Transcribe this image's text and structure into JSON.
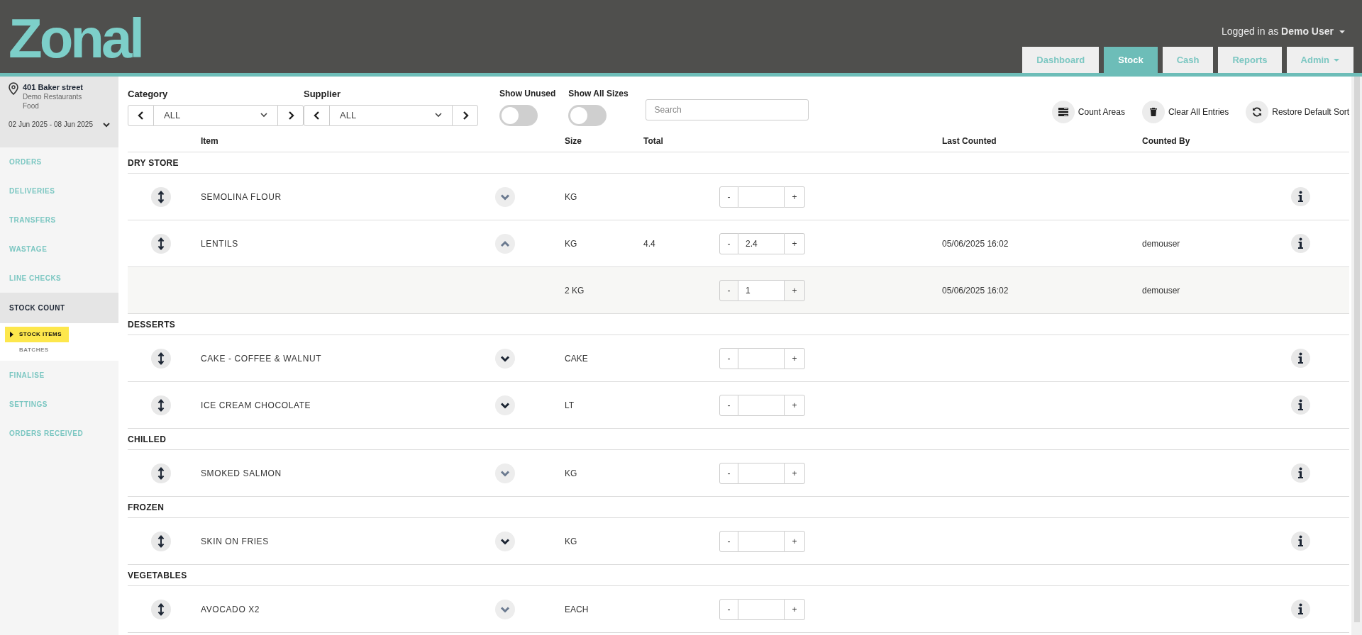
{
  "header": {
    "logo": "Zonal",
    "user": "Logged in as **Demo User**",
    "tabs": [
      {
        "label": "Dashboard",
        "selected": false,
        "dropdown": false
      },
      {
        "label": "Stock",
        "selected": true,
        "dropdown": false
      },
      {
        "label": "Cash",
        "selected": false,
        "dropdown": false
      },
      {
        "label": "Reports",
        "selected": false,
        "dropdown": false
      },
      {
        "label": "Admin",
        "selected": false,
        "dropdown": true
      }
    ]
  },
  "sidebar": {
    "location": {
      "name": "401 Baker street",
      "company": "Demo Restaurants",
      "type": "Food",
      "period": "02 Jun 2025 - 08 Jun 2025"
    },
    "items": [
      {
        "label": "ORDERS",
        "selected": false
      },
      {
        "label": "DELIVERIES",
        "selected": false
      },
      {
        "label": "TRANSFERS",
        "selected": false
      },
      {
        "label": "WASTAGE",
        "selected": false
      },
      {
        "label": "LINE CHECKS",
        "selected": false
      },
      {
        "label": "STOCK COUNT",
        "selected": true,
        "children": [
          {
            "label": "STOCK ITEMS",
            "selected": true
          },
          {
            "label": "BATCHES",
            "selected": false
          }
        ]
      },
      {
        "label": "FINALISE",
        "selected": false
      },
      {
        "label": "SETTINGS",
        "selected": false
      },
      {
        "label": "ORDERS RECEIVED",
        "selected": false
      }
    ]
  },
  "filters": {
    "category": {
      "label": "Category",
      "value": "ALL"
    },
    "supplier": {
      "label": "Supplier",
      "value": "ALL"
    },
    "toggles": [
      {
        "label": "Show Unused",
        "on": false
      },
      {
        "label": "Show All Sizes",
        "on": false
      }
    ],
    "search": {
      "placeholder": "Search"
    }
  },
  "actions": [
    {
      "label": "Count Areas",
      "kind": "areas"
    },
    {
      "label": "Clear All Entries",
      "kind": "trash"
    },
    {
      "label": "Restore Default Sort",
      "kind": "refresh"
    }
  ],
  "table": {
    "columns": [
      "Item",
      "Size",
      "Total",
      "Last Counted",
      "Counted By"
    ],
    "sections": [
      {
        "name": "DRY STORE",
        "rows": [
          {
            "name": "SEMOLINA FLOUR",
            "size": "KG",
            "minus": "-",
            "plus": "+",
            "count": "",
            "emphasized": false,
            "expanded": false
          },
          {
            "name": "LENTILS",
            "size": "KG",
            "total": "4.4",
            "minus": "-",
            "plus": "+",
            "count": "2.4",
            "last_counted": "05/06/2025 16:02",
            "counted_by": "demouser",
            "emphasized": false,
            "expanded": true,
            "sizes": [
              {
                "size": "2 KG",
                "minus": "-",
                "plus": "+",
                "count": "1",
                "last_counted": "05/06/2025 16:02",
                "counted_by": "demouser"
              }
            ]
          }
        ]
      },
      {
        "name": "DESSERTS",
        "rows": [
          {
            "name": "CAKE - COFFEE & WALNUT",
            "size": "CAKE",
            "minus": "-",
            "plus": "+",
            "count": "",
            "emphasized": true,
            "expanded": false
          },
          {
            "name": "ICE CREAM CHOCOLATE",
            "size": "LT",
            "minus": "-",
            "plus": "+",
            "count": "",
            "emphasized": true,
            "expanded": false
          }
        ]
      },
      {
        "name": "CHILLED",
        "rows": [
          {
            "name": "SMOKED SALMON",
            "size": "KG",
            "minus": "-",
            "plus": "+",
            "count": "",
            "emphasized": false,
            "expanded": false
          }
        ]
      },
      {
        "name": "FROZEN",
        "rows": [
          {
            "name": "SKIN ON FRIES",
            "size": "KG",
            "minus": "-",
            "plus": "+",
            "count": "",
            "emphasized": true,
            "expanded": false
          }
        ]
      },
      {
        "name": "VEGETABLES",
        "rows": [
          {
            "name": "AVOCADO X2",
            "size": "EACH",
            "minus": "-",
            "plus": "+",
            "count": "",
            "emphasized": false,
            "expanded": false
          }
        ]
      }
    ]
  }
}
